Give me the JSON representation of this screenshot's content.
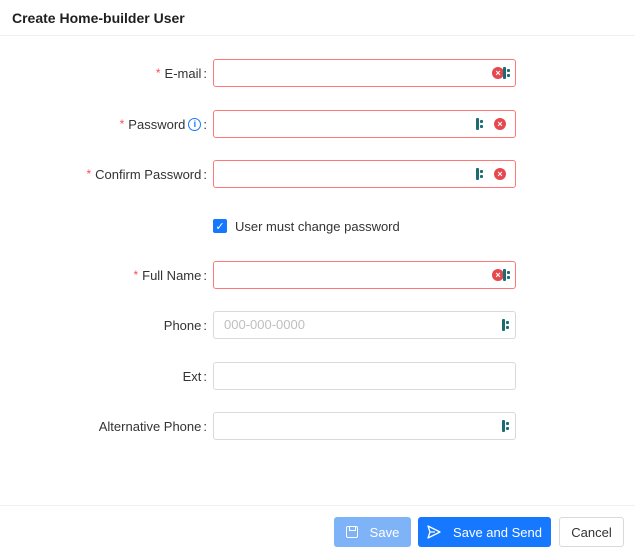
{
  "header": {
    "title": "Create Home-builder User"
  },
  "form": {
    "email": {
      "required_mark": "*",
      "label": "E-mail",
      "colon": ":"
    },
    "password": {
      "required_mark": "*",
      "label": "Password",
      "colon": ":",
      "info_glyph": "i"
    },
    "confirm_password": {
      "required_mark": "*",
      "label": "Confirm Password",
      "colon": ":"
    },
    "must_change": {
      "label": "User must change password",
      "checked": true,
      "check_glyph": "✓"
    },
    "full_name": {
      "required_mark": "*",
      "label": "Full Name",
      "colon": ":"
    },
    "phone": {
      "label": "Phone",
      "colon": ":",
      "placeholder": "000-000-0000"
    },
    "ext": {
      "label": "Ext",
      "colon": ":"
    },
    "alt_phone": {
      "label": "Alternative Phone",
      "colon": ":"
    }
  },
  "icons": {
    "clear": "×"
  },
  "footer": {
    "save_label": "Save",
    "save_send_label": "Save and Send",
    "cancel_label": "Cancel"
  },
  "colors": {
    "primary": "#1677ff",
    "primary_disabled": "#7fb3f7",
    "error": "#ff4d4f",
    "lastpass": "#1b6b73"
  }
}
